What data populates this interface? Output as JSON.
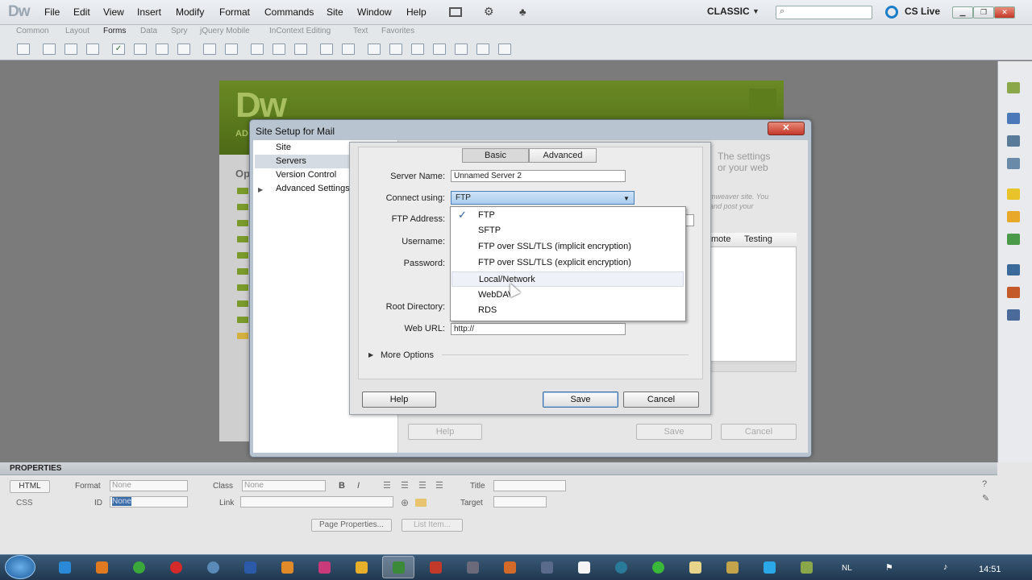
{
  "app": {
    "logo": "Dw",
    "workspace": "CLASSIC",
    "cslive": "CS Live"
  },
  "menus": [
    "File",
    "Edit",
    "View",
    "Insert",
    "Modify",
    "Format",
    "Commands",
    "Site",
    "Window",
    "Help"
  ],
  "insert_tabs": [
    "Common",
    "Layout",
    "Forms",
    "Data",
    "Spry",
    "jQuery Mobile",
    "InContext Editing",
    "Text",
    "Favorites"
  ],
  "welcome": {
    "logo": "Dw",
    "sub": "AD",
    "op": "Op"
  },
  "outer_dialog": {
    "title": "Site Setup for Mail",
    "nav": [
      "Site",
      "Servers",
      "Version Control",
      "Advanced Settings"
    ],
    "bg_text1": [
      "The settings",
      "or your web"
    ],
    "bg_text2": [
      "mweaver site. You",
      "and post your"
    ],
    "table_headers": [
      "mote",
      "Testing"
    ],
    "buttons": {
      "help": "Help",
      "save": "Save",
      "cancel": "Cancel"
    }
  },
  "server_dialog": {
    "tabs": {
      "basic": "Basic",
      "advanced": "Advanced"
    },
    "labels": {
      "server_name": "Server Name:",
      "connect_using": "Connect using:",
      "ftp_address": "FTP Address:",
      "username": "Username:",
      "password": "Password:",
      "root_directory": "Root Directory:",
      "web_url": "Web URL:"
    },
    "values": {
      "server_name": "Unnamed Server 2",
      "connect_using": "FTP",
      "web_url": "http://"
    },
    "more_options": "More Options",
    "buttons": {
      "help": "Help",
      "save": "Save",
      "cancel": "Cancel"
    }
  },
  "connect_dropdown": {
    "items": [
      "FTP",
      "SFTP",
      "FTP over SSL/TLS (implicit encryption)",
      "FTP over SSL/TLS (explicit encryption)",
      "Local/Network",
      "WebDAV",
      "RDS"
    ],
    "checked": "FTP",
    "hovered": "Local/Network"
  },
  "properties": {
    "title": "PROPERTIES",
    "html": "HTML",
    "css": "CSS",
    "format_label": "Format",
    "format_value": "None",
    "class_label": "Class",
    "class_value": "None",
    "id_label": "ID",
    "id_value": "None",
    "link_label": "Link",
    "title_label": "Title",
    "target_label": "Target",
    "page_properties": "Page Properties...",
    "list_item": "List Item..."
  },
  "taskbar": {
    "lang": "NL",
    "time": "14:51"
  },
  "colors": {
    "accent": "#3b6ea5",
    "dw_green": "#6a8a24",
    "taskbar": "#20384f"
  }
}
